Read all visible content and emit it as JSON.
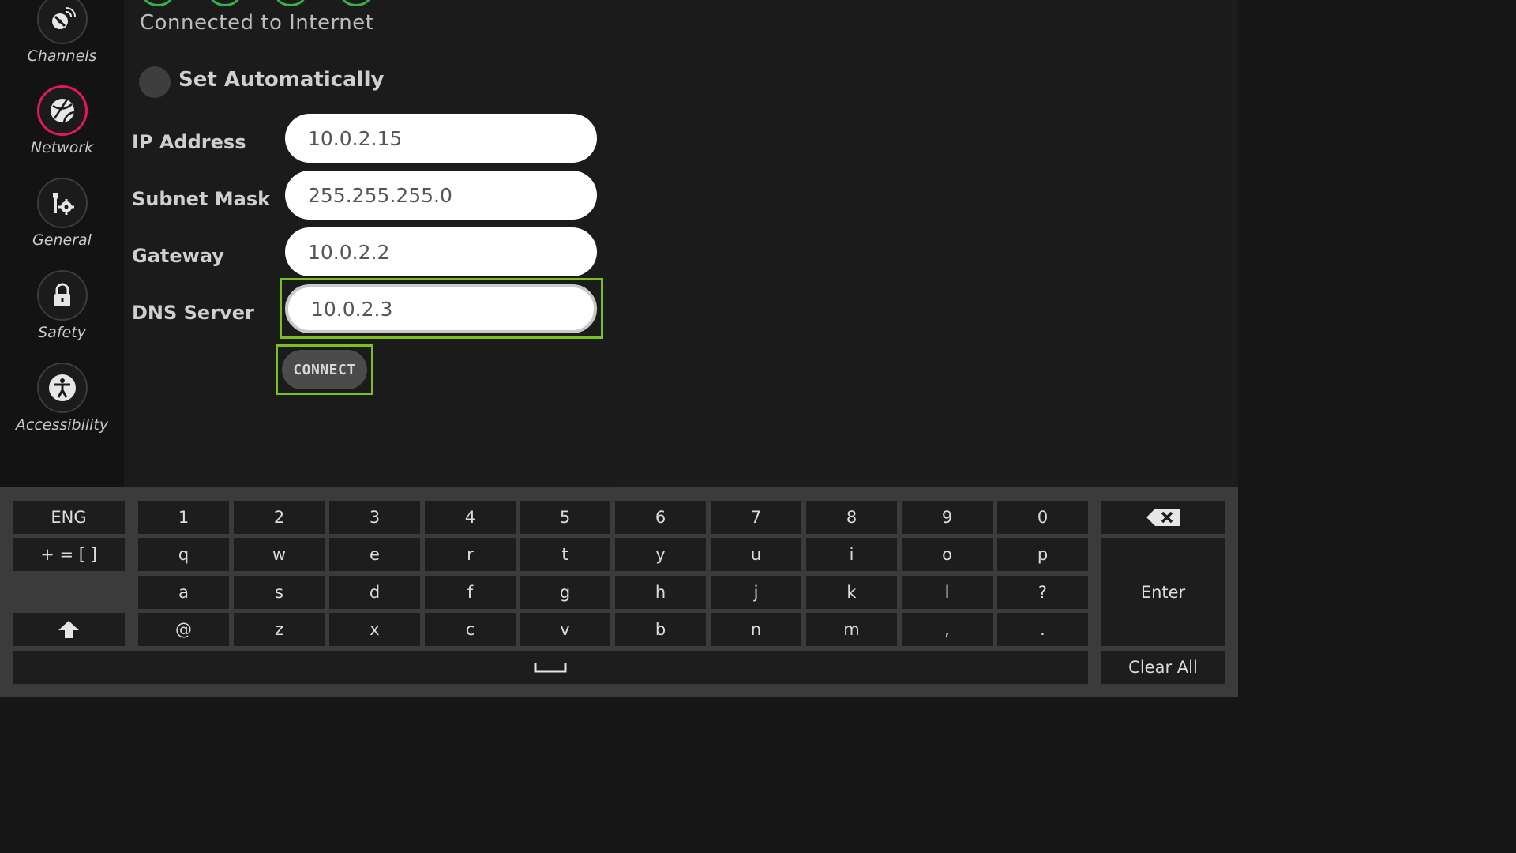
{
  "sidebar": {
    "items": [
      {
        "label": "Channels",
        "icon": "satellite-dish-icon"
      },
      {
        "label": "Network",
        "icon": "globe-icon",
        "active": true
      },
      {
        "label": "General",
        "icon": "wrench-gear-icon"
      },
      {
        "label": "Safety",
        "icon": "lock-icon"
      },
      {
        "label": "Accessibility",
        "icon": "accessibility-icon"
      }
    ],
    "accent_color": "#e2185e"
  },
  "network": {
    "status": "Connected to Internet",
    "status_color": "#35b24a",
    "set_automatically_label": "Set Automatically",
    "fields": [
      {
        "label": "IP Address",
        "value": "10.0.2.15"
      },
      {
        "label": "Subnet Mask",
        "value": "255.255.255.0"
      },
      {
        "label": "Gateway",
        "value": "10.0.2.2"
      },
      {
        "label": "DNS Server",
        "value": "10.0.2.3"
      }
    ],
    "connect_label": "CONNECT",
    "focus_color": "#7cc01e"
  },
  "keyboard": {
    "lang_label": "ENG",
    "symbols_label": "+ = [ ]",
    "row1": [
      "1",
      "2",
      "3",
      "4",
      "5",
      "6",
      "7",
      "8",
      "9",
      "0"
    ],
    "row2": [
      "q",
      "w",
      "e",
      "r",
      "t",
      "y",
      "u",
      "i",
      "o",
      "p"
    ],
    "row3": [
      "a",
      "s",
      "d",
      "f",
      "g",
      "h",
      "j",
      "k",
      "l",
      "?"
    ],
    "row4": [
      "@",
      "z",
      "x",
      "c",
      "v",
      "b",
      "n",
      "m",
      ",",
      "."
    ],
    "enter_label": "Enter",
    "clear_all_label": "Clear All"
  }
}
